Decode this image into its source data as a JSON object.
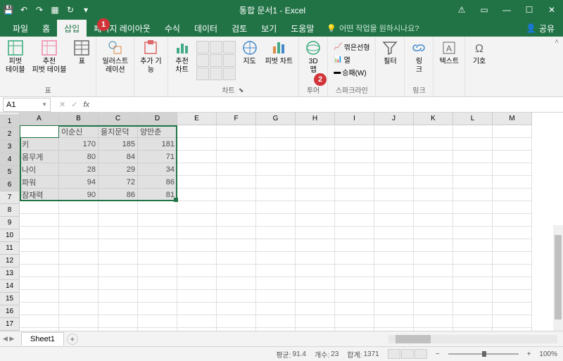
{
  "title": "통합 문서1 - Excel",
  "menus": [
    "파일",
    "홈",
    "삽입",
    "페이지 레이아웃",
    "수식",
    "데이터",
    "검토",
    "보기",
    "도움말"
  ],
  "active_menu_idx": 2,
  "tell_me": "어떤 작업을 원하시나요?",
  "share": "공유",
  "ribbon": {
    "groups": [
      {
        "label": "표",
        "items": [
          "피벗\n테이블",
          "추천\n피벗 테이블",
          "표"
        ]
      },
      {
        "label": "",
        "items": [
          "일러스트\n레이션"
        ]
      },
      {
        "label": "",
        "items": [
          "추가 기\n능"
        ]
      },
      {
        "label": "차트",
        "items": [
          "추천\n차트"
        ]
      },
      {
        "label": "",
        "items": [
          "지도",
          "피벗 차트"
        ]
      },
      {
        "label": "투어",
        "items": [
          "3D\n맵"
        ]
      },
      {
        "label": "스파크라인",
        "small": [
          "꺾은선형",
          "열",
          "승패(W)"
        ]
      },
      {
        "label": "",
        "items": [
          "필터"
        ]
      },
      {
        "label": "링크",
        "items": [
          "링\n크"
        ]
      },
      {
        "label": "",
        "items": [
          "텍스트"
        ]
      },
      {
        "label": "",
        "items": [
          "기호"
        ]
      }
    ]
  },
  "name_box": "A1",
  "columns": [
    "A",
    "B",
    "C",
    "D",
    "E",
    "F",
    "G",
    "H",
    "I",
    "J",
    "K",
    "L",
    "M"
  ],
  "row_count": 17,
  "table": {
    "headers": [
      "",
      "이순신",
      "을지문덕",
      "양만춘"
    ],
    "rows": [
      {
        "label": "키",
        "vals": [
          170,
          185,
          181
        ]
      },
      {
        "label": "몸무게",
        "vals": [
          80,
          84,
          71
        ]
      },
      {
        "label": "나이",
        "vals": [
          28,
          29,
          34
        ]
      },
      {
        "label": "파워",
        "vals": [
          94,
          72,
          86
        ]
      },
      {
        "label": "잠재력",
        "vals": [
          90,
          86,
          81
        ]
      }
    ]
  },
  "sheet_name": "Sheet1",
  "status": {
    "avg_label": "평균:",
    "avg": "91.4",
    "count_label": "개수:",
    "count": "23",
    "sum_label": "합계:",
    "sum": "1371",
    "zoom": "100%"
  },
  "callouts": {
    "1": "1",
    "2": "2"
  }
}
